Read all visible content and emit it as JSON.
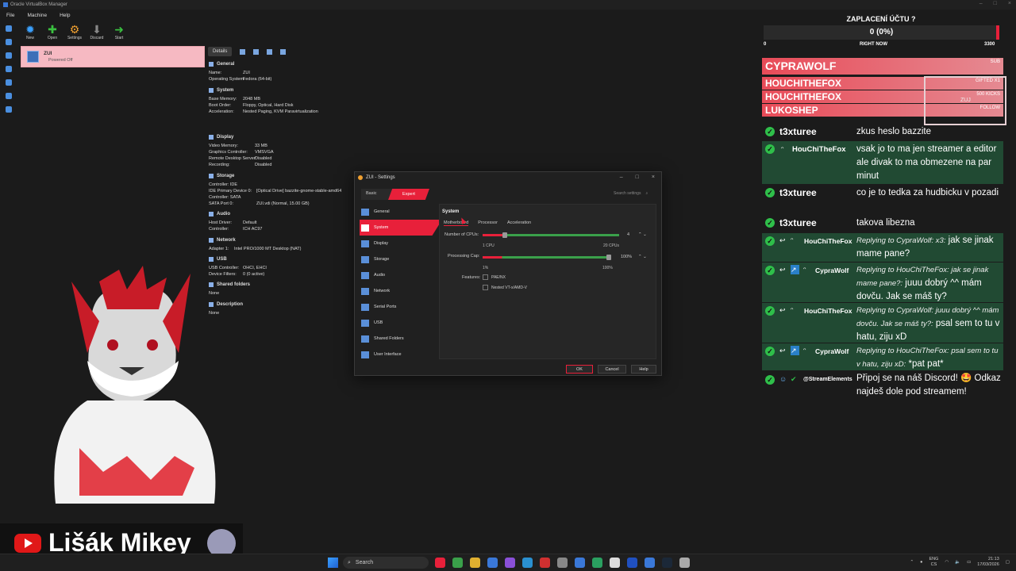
{
  "window": {
    "title": "Oracle VirtualBox Manager"
  },
  "menubar": [
    "File",
    "Machine",
    "Help"
  ],
  "toolbar": [
    {
      "label": "New",
      "glyph": "✹",
      "color": "#3aa0ff"
    },
    {
      "label": "Open",
      "glyph": "✚",
      "color": "#3ac040"
    },
    {
      "label": "Settings",
      "glyph": "⚙",
      "color": "#f0a030"
    },
    {
      "label": "Discard",
      "glyph": "⬇",
      "color": "#888888"
    },
    {
      "label": "Start",
      "glyph": "➜",
      "color": "#3ac040"
    }
  ],
  "vm": {
    "name": "ZUI",
    "state": "Powered Off"
  },
  "details_tab": "Details",
  "details": {
    "general": {
      "header": "General",
      "rows": [
        [
          "Name:",
          "ZUI"
        ],
        [
          "Operating System:",
          "Fedora (64-bit)"
        ]
      ]
    },
    "system": {
      "header": "System",
      "rows": [
        [
          "Base Memory:",
          "2048 MB"
        ],
        [
          "Boot Order:",
          "Floppy, Optical, Hard Disk"
        ],
        [
          "Acceleration:",
          "Nested Paging, KVM Paravirtualization"
        ]
      ]
    },
    "display": {
      "header": "Display",
      "rows": [
        [
          "Video Memory:",
          "33 MB"
        ],
        [
          "Graphics Controller:",
          "VMSVGA"
        ],
        [
          "Remote Desktop Server:",
          "Disabled"
        ],
        [
          "Recording:",
          "Disabled"
        ]
      ]
    },
    "storage": {
      "header": "Storage",
      "rows": [
        [
          "Controller: IDE",
          ""
        ],
        [
          " IDE Primary Device 0:",
          "[Optical Drive] bazzite-gnome-stable-amd64"
        ],
        [
          "Controller: SATA",
          ""
        ],
        [
          " SATA Port 0:",
          "ZUI.vdi (Normal, 15.00 GB)"
        ]
      ]
    },
    "audio": {
      "header": "Audio",
      "rows": [
        [
          "Host Driver:",
          "Default"
        ],
        [
          "Controller:",
          "ICH AC97"
        ]
      ]
    },
    "network": {
      "header": "Network",
      "rows": [
        [
          "Adapter 1:",
          "Intel PRO/1000 MT Desktop (NAT)"
        ]
      ]
    },
    "usb": {
      "header": "USB",
      "rows": [
        [
          "USB Controller:",
          "OHCI, EHCI"
        ],
        [
          "Device Filters:",
          "0 (0 active)"
        ]
      ]
    },
    "shared": {
      "header": "Shared folders",
      "rows": [
        [
          "None",
          ""
        ]
      ]
    },
    "description": {
      "header": "Description",
      "rows": [
        [
          "None",
          ""
        ]
      ]
    }
  },
  "dialog": {
    "title": "ZUI - Settings",
    "mode_basic": "Basic",
    "mode_expert": "Expert",
    "search_placeholder": "Search settings",
    "nav": [
      "General",
      "System",
      "Display",
      "Storage",
      "Audio",
      "Network",
      "Serial Ports",
      "USB",
      "Shared Folders",
      "User Interface"
    ],
    "selected_nav": "System",
    "panel_title": "System",
    "subtabs": [
      "Motherboard",
      "Processor",
      "Acceleration"
    ],
    "cpu": {
      "label": "Number of CPUs:",
      "value": "4",
      "min": "1 CPU",
      "max": "20 CPUs",
      "fraction": 0.16
    },
    "cap": {
      "label": "Processing Cap:",
      "value": "100%",
      "min": "1%",
      "max": "100%",
      "fraction": 1.0
    },
    "features_label": "Features:",
    "features": [
      "PAE/NX",
      "Nested VT-x/AMD-V"
    ],
    "buttons": {
      "ok": "OK",
      "cancel": "Cancel",
      "help": "Help"
    }
  },
  "goal": {
    "title": "ZAPLACENÍ ÚČTU ?",
    "value": "0 (0%)",
    "min": "0",
    "mid": "RIGHT NOW",
    "max": "3300",
    "fraction": 0.0
  },
  "events": [
    {
      "name": "CYPRAWOLF",
      "tag": "SUB"
    },
    {
      "name": "HOUCHITHEFOX",
      "tag": "GIFTED X1"
    },
    {
      "name": "HOUCHITHEFOX",
      "tag": "500 KICKS"
    },
    {
      "name": "LUKOSHEP",
      "tag": "FOLLOW"
    }
  ],
  "events_box_label": "ZUJ",
  "chat": [
    {
      "user": "t3xturee",
      "msg": "zkus heslo bazzite"
    },
    {
      "user": "HouChiTheFox",
      "msg": "vsak jo to ma jen streamer a editor ale divak to ma obmezene na par minut"
    },
    {
      "user": "t3xturee",
      "msg": "co je to tedka za hudbicku v pozadi"
    },
    {
      "user": "t3xturee",
      "msg": "takova libezna"
    },
    {
      "user": "HouChiTheFox",
      "reply": "Replying to CypraWolf: x3:",
      "msg": "jak se jinak mame pane?"
    },
    {
      "user": "CypraWolf",
      "reply": "Replying to HouChiTheFox: jak se jinak mame pane?:",
      "msg": "juuu dobrý ^^ mám dovču. Jak se máš ty?"
    },
    {
      "user": "HouChiTheFox",
      "reply": "Replying to CypraWolf: juuu dobrý ^^ mám dovču. Jak se máš ty?:",
      "msg": "psal sem to tu v hatu, ziju xD"
    },
    {
      "user": "CypraWolf",
      "reply": "Replying to HouChiTheFox: psal sem to tu v hatu, ziju xD:",
      "msg": "*pat pat*"
    },
    {
      "user": "@StreamElements",
      "msg": "Připoj se na náš Discord! 🤩 Odkaz najdeš dole pod streamem!"
    }
  ],
  "nametag": {
    "name": "Lišák Mikey"
  },
  "taskbar": {
    "search": "Search",
    "lang_top": "ENG",
    "lang_bottom": "CS",
    "time": "21:13",
    "date": "17/03/2026"
  }
}
